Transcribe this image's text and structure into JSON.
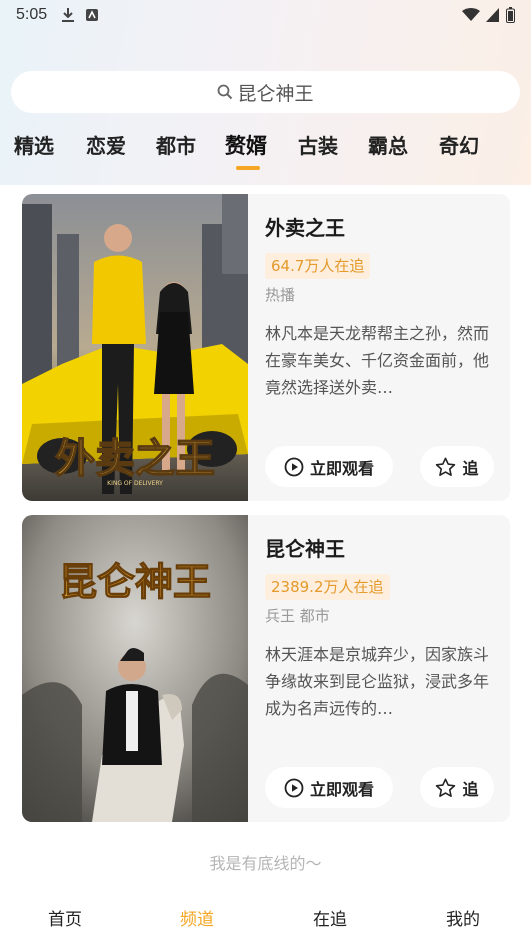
{
  "status": {
    "time": "5:05"
  },
  "search": {
    "text": "昆仑神王"
  },
  "tabs": [
    {
      "label": "精选"
    },
    {
      "label": "恋爱"
    },
    {
      "label": "都市"
    },
    {
      "label": "赘婿",
      "active": true
    },
    {
      "label": "古装"
    },
    {
      "label": "霸总"
    },
    {
      "label": "奇幻"
    }
  ],
  "cards": [
    {
      "title": "外卖之王",
      "badge": "64.7万人在追",
      "tags": "热播",
      "desc": "林凡本是天龙帮帮主之孙，然而在豪车美女、千亿资金面前，他竟然选择送外卖…",
      "poster_title": "外卖之王",
      "poster_subtitle": "KING OF DELIVERY",
      "watch_label": "立即观看",
      "follow_label": "追"
    },
    {
      "title": "昆仑神王",
      "badge": "2389.2万人在追",
      "tags": "兵王 都市",
      "desc": "林天涯本是京城弃少，因家族斗争缘故来到昆仑监狱，浸武多年成为名声远传的…",
      "poster_title": "昆仑神王",
      "watch_label": "立即观看",
      "follow_label": "追"
    }
  ],
  "footer_note": "我是有底线的～",
  "bottom_nav": [
    {
      "label": "首页"
    },
    {
      "label": "频道",
      "active": true
    },
    {
      "label": "在追"
    },
    {
      "label": "我的"
    }
  ],
  "colors": {
    "accent": "#f5a623",
    "badge_bg": "#fdeedd",
    "badge_text": "#e49a2c"
  }
}
